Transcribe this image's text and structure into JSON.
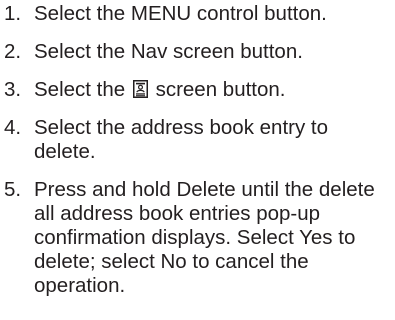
{
  "steps": [
    {
      "number": "1.",
      "text": "Select the MENU control button."
    },
    {
      "number": "2.",
      "text": "Select the Nav screen button."
    },
    {
      "number": "3.",
      "text_before": "Select the",
      "icon": "address-book-icon",
      "text_after": "screen button."
    },
    {
      "number": "4.",
      "text": "Select the address book entry to delete."
    },
    {
      "number": "5.",
      "text": "Press and hold Delete until the delete all address book entries pop-up confirmation displays. Select Yes to delete; select No to cancel the operation."
    }
  ]
}
